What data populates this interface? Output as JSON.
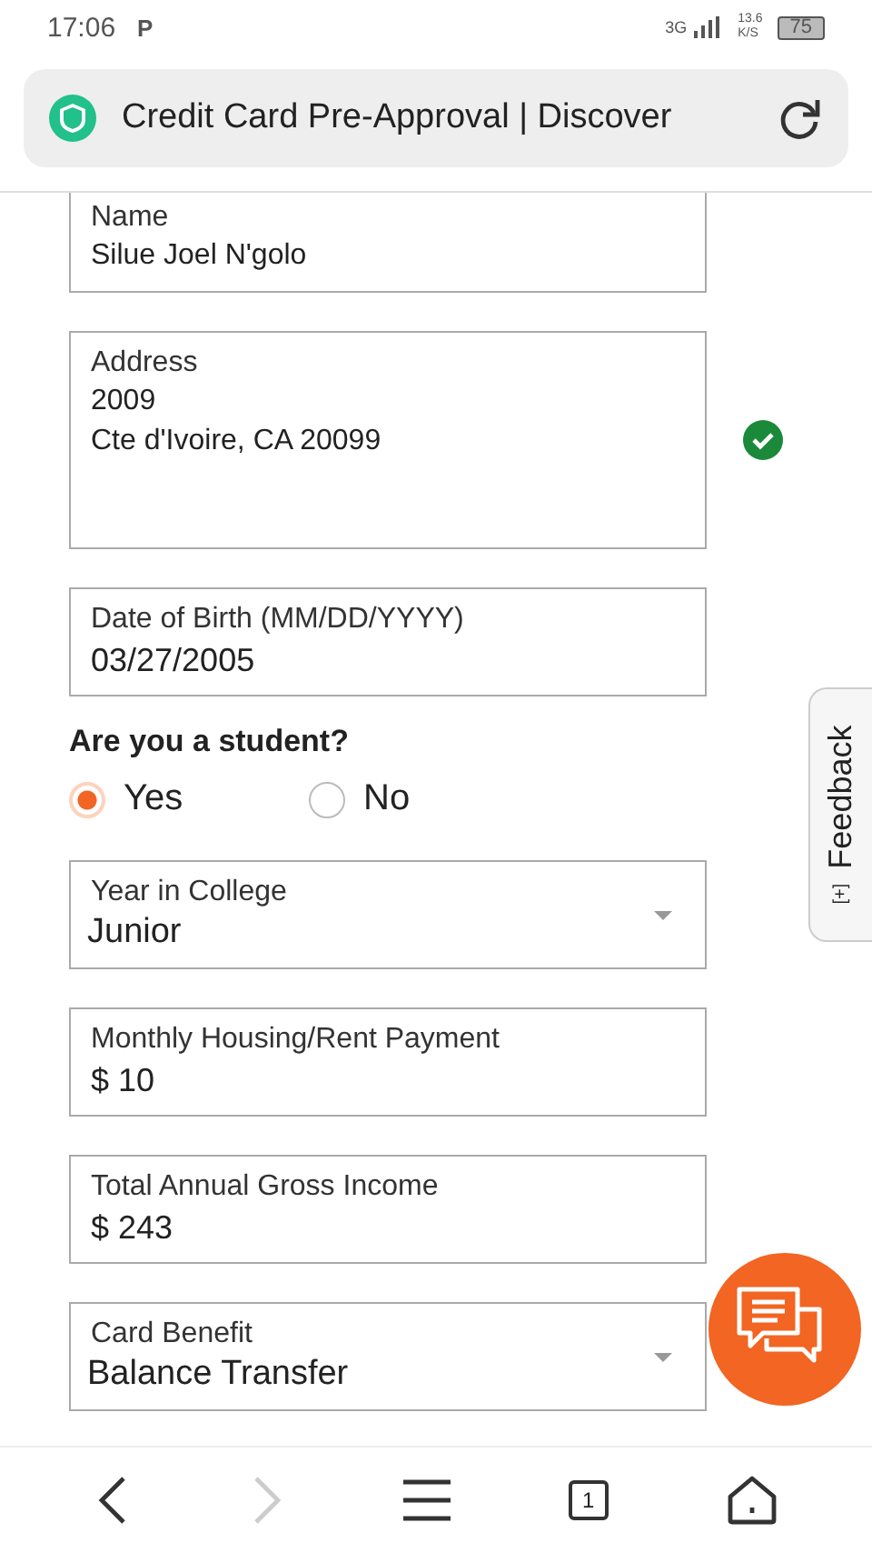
{
  "status_bar": {
    "time": "17:06",
    "notification": "P",
    "network": "3G",
    "speed": "13.6",
    "speed_unit": "K/S",
    "battery": "75"
  },
  "address_bar": {
    "title": "Credit Card Pre-Approval | Discover"
  },
  "form": {
    "fields_top": [
      {
        "kind": "display",
        "label": "Name",
        "lines": [
          "Silue Joel N'golo"
        ],
        "valid": false
      },
      {
        "kind": "display",
        "label": "Address",
        "lines": [
          "2009",
          "Cte d'Ivoire, CA 20099"
        ],
        "valid": true
      },
      {
        "kind": "input",
        "label": "Date of Birth (MM/DD/YYYY)",
        "lines": [
          "03/27/2005"
        ],
        "valid": false
      }
    ],
    "question": "Are you a student?",
    "options": [
      {
        "label": "Yes",
        "selected": true
      },
      {
        "label": "No",
        "selected": false
      }
    ],
    "fields_bottom": [
      {
        "kind": "select",
        "label": "Year in College",
        "lines": [
          "Junior"
        ],
        "valid": false
      },
      {
        "kind": "input",
        "label": "Monthly Housing/Rent Payment",
        "lines": [
          "$ 10"
        ],
        "valid": false
      },
      {
        "kind": "input",
        "label": "Total Annual Gross Income",
        "lines": [
          "$ 243"
        ],
        "valid": false
      },
      {
        "kind": "select",
        "label": "Card Benefit",
        "lines": [
          "Balance Transfer"
        ],
        "valid": false
      }
    ]
  },
  "feedback_tab": {
    "label": "Feedback",
    "icon_text": "[+]"
  },
  "nav": {
    "tabs_count": "1"
  }
}
